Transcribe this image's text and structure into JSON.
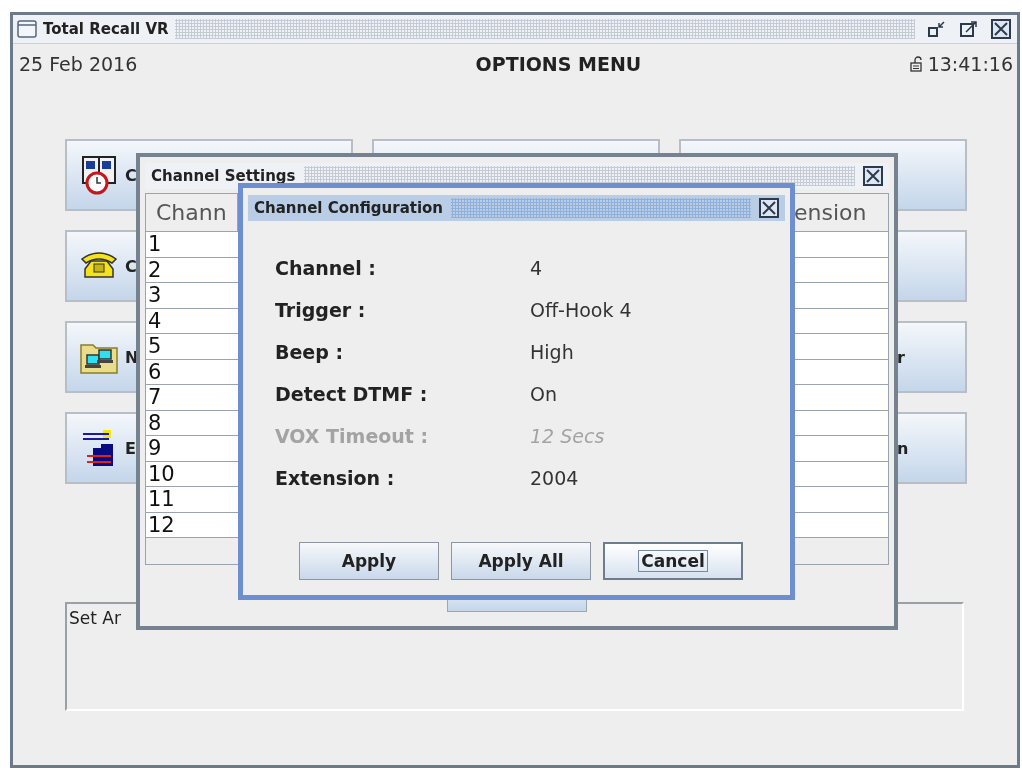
{
  "window": {
    "title": "Total Recall VR"
  },
  "header": {
    "date": "25 Feb 2016",
    "title": "OPTIONS MENU",
    "time": "13:41:16"
  },
  "menu_rows": [
    {
      "left_label": "C",
      "middle": true
    },
    {
      "left_label": "C"
    },
    {
      "left_label": "N",
      "right_label": "r"
    },
    {
      "left_label": "E",
      "right_label": "n"
    }
  ],
  "status_text": "Set Ar",
  "channel_settings": {
    "title": "Channel Settings",
    "columns": [
      "Chann",
      "ension"
    ],
    "rows": [
      "1",
      "2",
      "3",
      "4",
      "5",
      "6",
      "7",
      "8",
      "9",
      "10",
      "11",
      "12"
    ]
  },
  "channel_configuration": {
    "title": "Channel Configuration",
    "fields": [
      {
        "label": "Channel :",
        "value": "4",
        "disabled": false
      },
      {
        "label": "Trigger :",
        "value": "Off-Hook 4",
        "disabled": false
      },
      {
        "label": "Beep :",
        "value": "High",
        "disabled": false
      },
      {
        "label": "Detect DTMF :",
        "value": "On",
        "disabled": false
      },
      {
        "label": "VOX Timeout :",
        "value": "12 Secs",
        "disabled": true
      },
      {
        "label": "Extension :",
        "value": "2004",
        "disabled": false
      }
    ],
    "buttons": [
      {
        "label": "Apply",
        "focused": false
      },
      {
        "label": "Apply All",
        "focused": false
      },
      {
        "label": "Cancel",
        "focused": true
      }
    ]
  }
}
